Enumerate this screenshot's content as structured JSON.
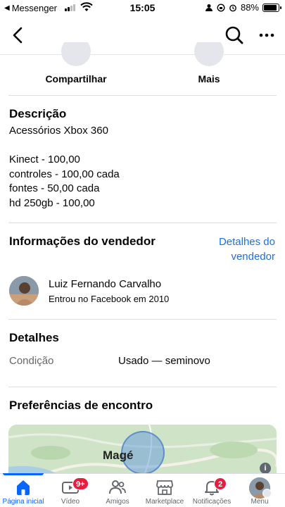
{
  "status_bar": {
    "back_app": "Messenger",
    "time": "15:05",
    "battery": "88%",
    "battery_level": 0.88
  },
  "header": {
    "back_icon": "chevron-left-icon",
    "search_icon": "search-icon",
    "more_icon": "more-horizontal-icon"
  },
  "actions": {
    "share_label": "Compartilhar",
    "more_label": "Mais"
  },
  "description": {
    "title": "Descrição",
    "lines": [
      "Acessórios Xbox 360",
      "",
      "Kinect - 100,00",
      "controles - 100,00 cada",
      "fontes - 50,00 cada",
      "hd 250gb - 100,00"
    ]
  },
  "seller": {
    "title": "Informações do vendedor",
    "details_link_line1": "Detalhes do",
    "details_link_line2": "vendedor",
    "name": "Luiz Fernando Carvalho",
    "joined": "Entrou no Facebook em 2010"
  },
  "details": {
    "title": "Detalhes",
    "condition_label": "Condição",
    "condition_value": "Usado — seminovo"
  },
  "meeting": {
    "title": "Preferências de encontro",
    "map_town": "Magé",
    "info_glyph": "i"
  },
  "tabbar": {
    "items": [
      {
        "label": "Página inicial",
        "icon": "home-icon",
        "active": true
      },
      {
        "label": "Vídeo",
        "icon": "video-icon",
        "badge": "9+"
      },
      {
        "label": "Amigos",
        "icon": "friends-icon"
      },
      {
        "label": "Marketplace",
        "icon": "marketplace-icon"
      },
      {
        "label": "Notificações",
        "icon": "bell-icon",
        "badge": "2"
      },
      {
        "label": "Menu",
        "icon": "menu-avatar-icon"
      }
    ]
  },
  "colors": {
    "accent": "#0866ff",
    "link": "#216fdb",
    "badge": "#e41e3f",
    "divider": "#dadde1"
  }
}
